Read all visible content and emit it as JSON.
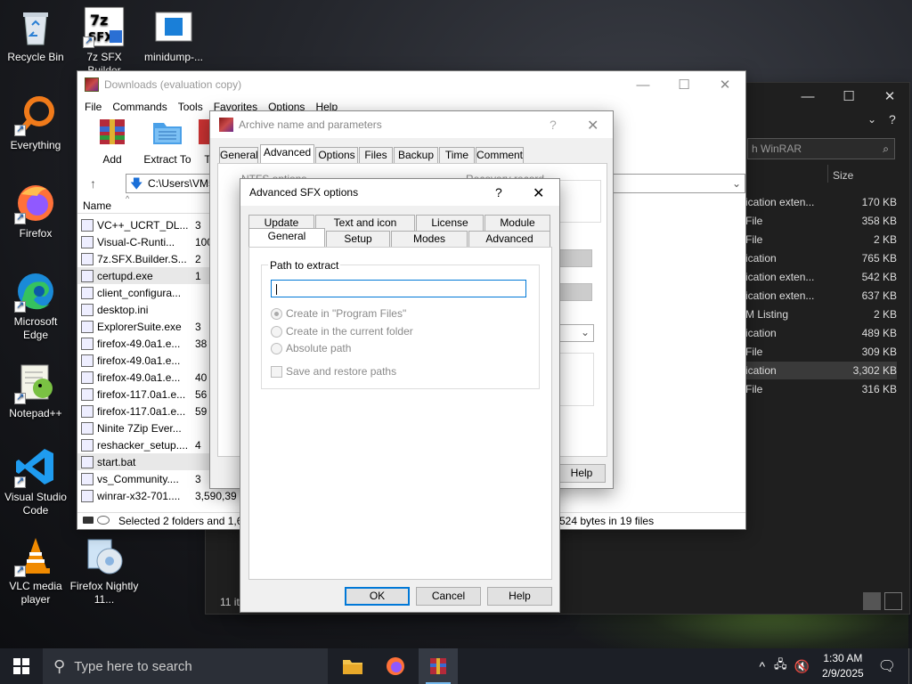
{
  "desktop": {
    "icons": [
      {
        "label": "Recycle Bin"
      },
      {
        "label": "7z SFX Builder"
      },
      {
        "label": "minidump-..."
      },
      {
        "label": "Everything"
      },
      {
        "label": "Firefox"
      },
      {
        "label": "Microsoft Edge"
      },
      {
        "label": "Notepad++"
      },
      {
        "label": "Visual Studio Code"
      },
      {
        "label": "VLC media player"
      },
      {
        "label": "Firefox Nightly 11..."
      }
    ]
  },
  "bgwindow": {
    "search_placeholder": "h WinRAR",
    "size_header": "Size",
    "rows": [
      {
        "type": "ication exten...",
        "size": "170 KB"
      },
      {
        "type": "File",
        "size": "358 KB"
      },
      {
        "type": "File",
        "size": "2 KB"
      },
      {
        "type": "ication",
        "size": "765 KB"
      },
      {
        "type": "ication exten...",
        "size": "542 KB"
      },
      {
        "type": "ication exten...",
        "size": "637 KB"
      },
      {
        "type": "M Listing",
        "size": "2 KB"
      },
      {
        "type": "ication",
        "size": "489 KB"
      },
      {
        "type": "File",
        "size": "309 KB"
      },
      {
        "type": "ication",
        "size": "3,302 KB"
      },
      {
        "type": "File",
        "size": "316 KB"
      }
    ],
    "status": "11 it"
  },
  "winrar": {
    "title": "Downloads (evaluation copy)",
    "menu": [
      "File",
      "Commands",
      "Tools",
      "Favorites",
      "Options",
      "Help"
    ],
    "tools": [
      "Add",
      "Extract To",
      "T"
    ],
    "path": "C:\\Users\\VM5",
    "name_header": "Name",
    "files": [
      {
        "name": "VC++_UCRT_DL...",
        "size": "3"
      },
      {
        "name": "Visual-C-Runti...",
        "size": "100"
      },
      {
        "name": "7z.SFX.Builder.S...",
        "size": "2"
      },
      {
        "name": "certupd.exe",
        "size": "1"
      },
      {
        "name": "client_configura...",
        "size": ""
      },
      {
        "name": "desktop.ini",
        "size": ""
      },
      {
        "name": "ExplorerSuite.exe",
        "size": "3"
      },
      {
        "name": "firefox-49.0a1.e...",
        "size": "38"
      },
      {
        "name": "firefox-49.0a1.e...",
        "size": ""
      },
      {
        "name": "firefox-49.0a1.e...",
        "size": "40"
      },
      {
        "name": "firefox-117.0a1.e...",
        "size": "56"
      },
      {
        "name": "firefox-117.0a1.e...",
        "size": "59"
      },
      {
        "name": "Ninite 7Zip Ever...",
        "size": ""
      },
      {
        "name": "reshacker_setup....",
        "size": "4"
      },
      {
        "name": "start.bat",
        "size": ""
      },
      {
        "name": "vs_Community....",
        "size": "3"
      },
      {
        "name": "winrar-x32-701....",
        "size": "3,590,39"
      }
    ],
    "status_left": "Selected 2 folders and 1,68",
    "status_right": "524 bytes in 19 files"
  },
  "archive_dialog": {
    "title": "Archive name and parameters",
    "tabs": [
      "General",
      "Advanced",
      "Options",
      "Files",
      "Backup",
      "Time",
      "Comment"
    ],
    "nt_label": "NTFS options",
    "recovery_label": "Recovery record",
    "help": "Help"
  },
  "sfx_dialog": {
    "title": "Advanced SFX options",
    "help_glyph": "?",
    "tabs_row1": [
      "Update",
      "Text and icon",
      "License",
      "Module"
    ],
    "tabs_row2": [
      "General",
      "Setup",
      "Modes",
      "Advanced"
    ],
    "group_label": "Path to extract",
    "path_value": "",
    "radios": [
      "Create in \"Program Files\"",
      "Create in the current folder",
      "Absolute path"
    ],
    "checkbox": "Save and restore paths",
    "ok": "OK",
    "cancel": "Cancel",
    "help": "Help"
  },
  "taskbar": {
    "search_placeholder": "Type here to search",
    "time": "1:30 AM",
    "date": "2/9/2025"
  }
}
